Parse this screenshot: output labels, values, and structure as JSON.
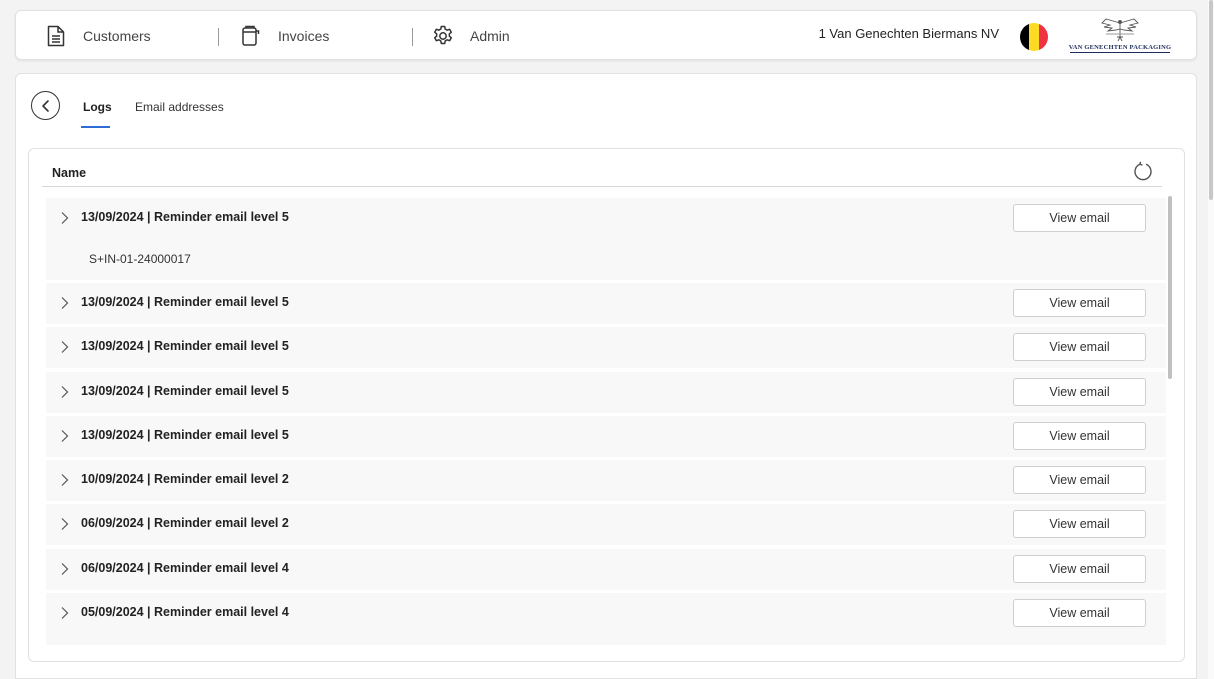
{
  "nav": {
    "items": [
      {
        "label": "Customers",
        "icon": "document-icon"
      },
      {
        "label": "Invoices",
        "icon": "invoice-icon"
      },
      {
        "label": "Admin",
        "icon": "gear-icon"
      }
    ],
    "company": "1 Van Genechten Biermans NV",
    "flag": "belgium-flag",
    "logo_text": "VAN GENECHTEN PACKAGING"
  },
  "tabs": {
    "logs": "Logs",
    "email_addresses": "Email addresses",
    "active": "Logs"
  },
  "table": {
    "header_name": "Name",
    "view_label": "View email",
    "rows": [
      {
        "title": "13/09/2024 | Reminder email level 5",
        "detail": "S+IN-01-24000017"
      },
      {
        "title": "13/09/2024 | Reminder email level 5"
      },
      {
        "title": "13/09/2024 | Reminder email level 5"
      },
      {
        "title": "13/09/2024 | Reminder email level 5"
      },
      {
        "title": "13/09/2024 | Reminder email level 5"
      },
      {
        "title": "10/09/2024 | Reminder email level 2"
      },
      {
        "title": "06/09/2024 | Reminder email level 2"
      },
      {
        "title": "06/09/2024 | Reminder email level 4"
      },
      {
        "title": "05/09/2024 | Reminder email level 4"
      }
    ]
  },
  "colors": {
    "accent": "#2e6bd6",
    "flag_black": "#000000",
    "flag_yellow": "#FDDA24",
    "flag_red": "#EF3340",
    "logo_navy": "#1e2d5a"
  }
}
